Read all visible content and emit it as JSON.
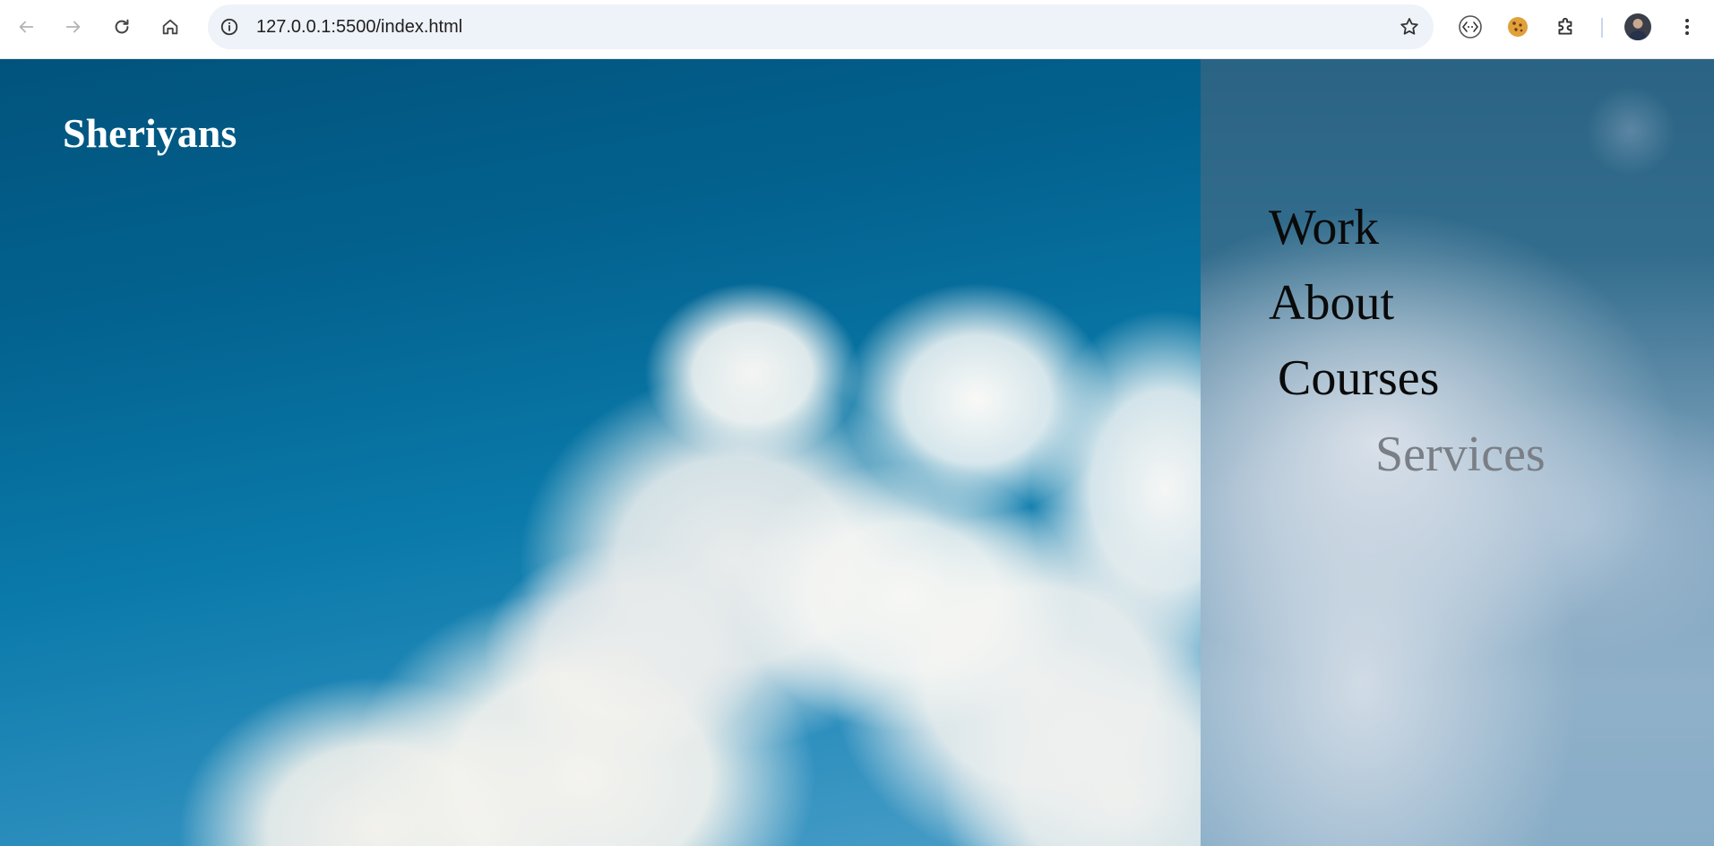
{
  "browser": {
    "url": "127.0.0.1:5500/index.html",
    "back_icon": "arrow-left-icon",
    "forward_icon": "arrow-right-icon",
    "reload_icon": "reload-icon",
    "home_icon": "home-icon",
    "info_icon": "info-icon",
    "bookmark_icon": "star-icon",
    "extensions": [
      "devtools-extension-icon",
      "cookie-extension-icon",
      "puzzle-icon"
    ],
    "menu_icon": "kebab-menu-icon"
  },
  "page": {
    "brand": "Sheriyans",
    "menu": [
      {
        "label": "Work",
        "state": "normal"
      },
      {
        "label": "About",
        "state": "normal"
      },
      {
        "label": "Courses",
        "state": "normal"
      },
      {
        "label": "Services",
        "state": "hover"
      }
    ]
  },
  "colors": {
    "sky_top": "#01537c",
    "sky_bottom": "#5aa6cc",
    "menu_text": "#0a0a0a",
    "menu_text_dim": "#7a7f86",
    "brand_text": "#ffffff"
  }
}
